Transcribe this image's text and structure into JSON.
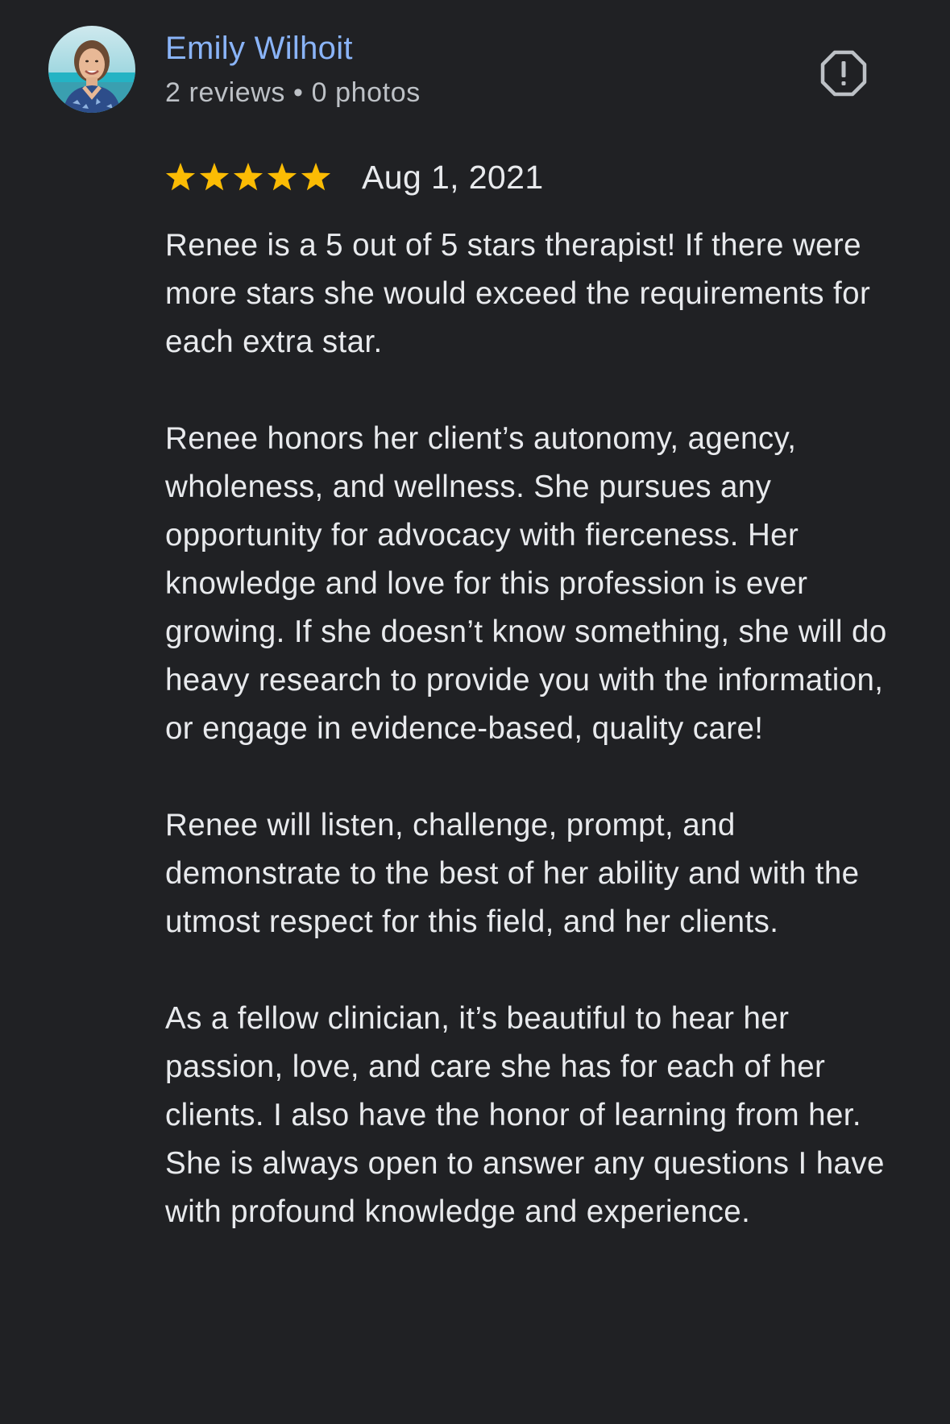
{
  "author": {
    "name": "Emily Wilhoit",
    "meta": "2 reviews • 0 photos",
    "avatar": "profile-photo"
  },
  "report": {
    "icon": "report-flag-icon",
    "color": "#bdc1c6"
  },
  "review": {
    "rating": 5,
    "rating_max": 5,
    "star_color": "#fbbc04",
    "date": "Aug 1, 2021",
    "paragraphs": [
      "Renee is a 5 out of 5 stars therapist! If there were more stars she would exceed the requirements for each extra star.",
      "Renee honors her client’s autonomy, agency, wholeness, and wellness. She pursues any opportunity for advocacy with fierceness. Her knowledge and love for this profession is ever growing. If she doesn’t know something, she will do heavy research to provide you with the information, or engage in evidence-based, quality care!",
      "Renee will listen, challenge, prompt, and demonstrate to the best of her ability and with the utmost respect for this field, and her clients.",
      "As a fellow clinician, it’s beautiful to hear her passion, love, and care she has for each of her clients. I also have the honor of learning from her. She is always open to answer any questions I have with profound knowledge and experience."
    ]
  },
  "colors": {
    "background": "#202124",
    "name": "#8ab4f8",
    "text": "#e8eaed",
    "secondary": "#bdc1c6"
  }
}
